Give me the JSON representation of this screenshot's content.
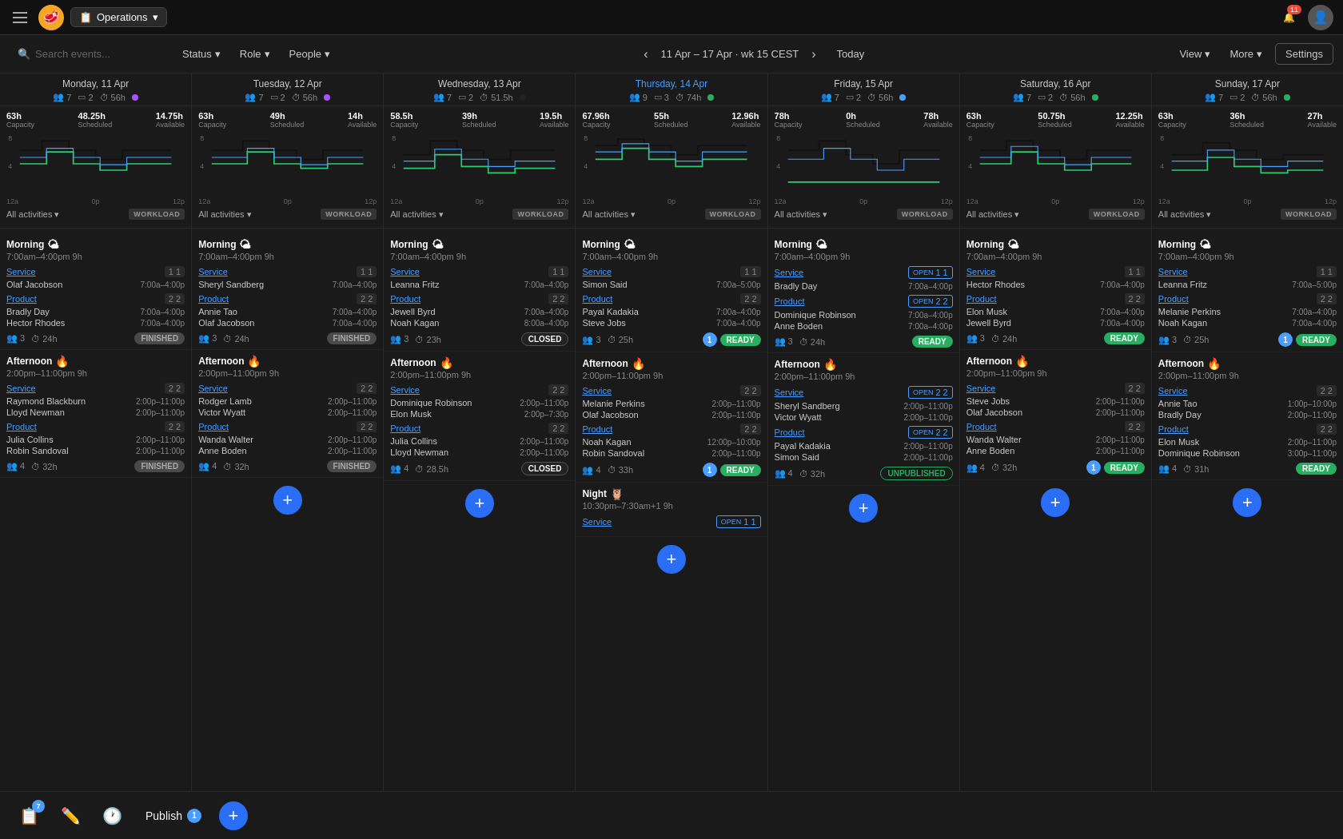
{
  "app": {
    "title": "Operations",
    "notif_count": "11"
  },
  "toolbar": {
    "search_placeholder": "Search events...",
    "status_label": "Status",
    "role_label": "Role",
    "people_label": "People",
    "week_label": "11 Apr – 17 Apr · wk 15   CEST",
    "today_label": "Today",
    "view_label": "View",
    "more_label": "More",
    "settings_label": "Settings"
  },
  "days": [
    {
      "title": "Monday, 11 Apr",
      "today": false,
      "stats": {
        "people": 7,
        "shifts": 2,
        "hours": "56h",
        "dot": "purple"
      },
      "capacity": {
        "cap": "63h",
        "sched": "48.25h",
        "avail": "14.75h"
      },
      "dot_color": "#a855f7",
      "shifts": [
        {
          "name": "Morning",
          "emoji": "🌤",
          "time": "7:00am–4:00pm 9h",
          "roles": [
            {
              "name": "Service",
              "count": "1 1",
              "open": false,
              "staff": [
                {
                  "name": "Olaf Jacobson",
                  "time": "7:00a–4:00p"
                }
              ]
            },
            {
              "name": "Product",
              "count": "2 2",
              "open": false,
              "staff": [
                {
                  "name": "Bradly Day",
                  "time": "7:00a–4:00p"
                },
                {
                  "name": "Hector Rhodes",
                  "time": "7:00a–4:00p"
                }
              ]
            }
          ],
          "footer": {
            "people": 3,
            "hours": "24h",
            "status": "FINISHED",
            "status_type": "finished",
            "num": null
          }
        },
        {
          "name": "Afternoon",
          "emoji": "🔥",
          "time": "2:00pm–11:00pm 9h",
          "roles": [
            {
              "name": "Service",
              "count": "2 2",
              "open": false,
              "staff": [
                {
                  "name": "Raymond Blackburn",
                  "time": "2:00p–11:00p"
                },
                {
                  "name": "Lloyd Newman",
                  "time": "2:00p–11:00p"
                }
              ]
            },
            {
              "name": "Product",
              "count": "2 2",
              "open": false,
              "staff": [
                {
                  "name": "Julia Collins",
                  "time": "2:00p–11:00p"
                },
                {
                  "name": "Robin Sandoval",
                  "time": "2:00p–11:00p"
                }
              ]
            }
          ],
          "footer": {
            "people": 4,
            "hours": "32h",
            "status": "FINISHED",
            "status_type": "finished",
            "num": null
          }
        }
      ]
    },
    {
      "title": "Tuesday, 12 Apr",
      "today": false,
      "stats": {
        "people": 7,
        "shifts": 2,
        "hours": "56h",
        "dot": "purple"
      },
      "capacity": {
        "cap": "63h",
        "sched": "49h",
        "avail": "14h"
      },
      "dot_color": "#a855f7",
      "shifts": [
        {
          "name": "Morning",
          "emoji": "🌤",
          "time": "7:00am–4:00pm 9h",
          "roles": [
            {
              "name": "Service",
              "count": "1 1",
              "open": false,
              "staff": [
                {
                  "name": "Sheryl Sandberg",
                  "time": "7:00a–4:00p"
                }
              ]
            },
            {
              "name": "Product",
              "count": "2 2",
              "open": false,
              "staff": [
                {
                  "name": "Annie Tao",
                  "time": "7:00a–4:00p"
                },
                {
                  "name": "Olaf Jacobson",
                  "time": "7:00a–4:00p"
                }
              ]
            }
          ],
          "footer": {
            "people": 3,
            "hours": "24h",
            "status": "FINISHED",
            "status_type": "finished",
            "num": null
          }
        },
        {
          "name": "Afternoon",
          "emoji": "🔥",
          "time": "2:00pm–11:00pm 9h",
          "roles": [
            {
              "name": "Service",
              "count": "2 2",
              "open": false,
              "staff": [
                {
                  "name": "Rodger Lamb",
                  "time": "2:00p–11:00p"
                },
                {
                  "name": "Victor Wyatt",
                  "time": "2:00p–11:00p"
                }
              ]
            },
            {
              "name": "Product",
              "count": "2 2",
              "open": false,
              "staff": [
                {
                  "name": "Wanda Walter",
                  "time": "2:00p–11:00p"
                },
                {
                  "name": "Anne Boden",
                  "time": "2:00p–11:00p"
                }
              ]
            }
          ],
          "footer": {
            "people": 4,
            "hours": "32h",
            "status": "FINISHED",
            "status_type": "finished",
            "num": null
          }
        }
      ]
    },
    {
      "title": "Wednesday, 13 Apr",
      "today": false,
      "stats": {
        "people": 7,
        "shifts": 2,
        "hours": "51.5h"
      },
      "capacity": {
        "cap": "58.5h",
        "sched": "39h",
        "avail": "19.5h"
      },
      "dot_color": "#222",
      "shifts": [
        {
          "name": "Morning",
          "emoji": "🌤",
          "time": "7:00am–4:00pm 9h",
          "roles": [
            {
              "name": "Service",
              "count": "1 1",
              "open": false,
              "staff": [
                {
                  "name": "Leanna Fritz",
                  "time": "7:00a–4:00p"
                }
              ]
            },
            {
              "name": "Product",
              "count": "2 2",
              "open": false,
              "staff": [
                {
                  "name": "Jewell Byrd",
                  "time": "7:00a–4:00p"
                },
                {
                  "name": "Noah Kagan",
                  "time": "8:00a–4:00p"
                }
              ]
            }
          ],
          "footer": {
            "people": 3,
            "hours": "23h",
            "status": "CLOSED",
            "status_type": "closed",
            "num": null
          }
        },
        {
          "name": "Afternoon",
          "emoji": "🔥",
          "time": "2:00pm–11:00pm 9h",
          "roles": [
            {
              "name": "Service",
              "count": "2 2",
              "open": false,
              "staff": [
                {
                  "name": "Dominique Robinson",
                  "time": "2:00p–11:00p"
                },
                {
                  "name": "Elon Musk",
                  "time": "2:00p–7:30p"
                }
              ]
            },
            {
              "name": "Product",
              "count": "2 2",
              "open": false,
              "staff": [
                {
                  "name": "Julia Collins",
                  "time": "2:00p–11:00p"
                },
                {
                  "name": "Lloyd Newman",
                  "time": "2:00p–11:00p"
                }
              ]
            }
          ],
          "footer": {
            "people": 4,
            "hours": "28.5h",
            "status": "CLOSED",
            "status_type": "closed",
            "num": null
          }
        }
      ]
    },
    {
      "title": "Thursday, 14 Apr",
      "today": true,
      "stats": {
        "people": 9,
        "shifts": 3,
        "hours": "74h"
      },
      "capacity": {
        "cap": "67.96h",
        "sched": "55h",
        "avail": "12.96h"
      },
      "dot_color": "#27ae60",
      "shifts": [
        {
          "name": "Morning",
          "emoji": "🌤",
          "time": "7:00am–4:00pm 9h",
          "roles": [
            {
              "name": "Service",
              "count": "1 1",
              "open": false,
              "staff": [
                {
                  "name": "Simon Said",
                  "time": "7:00a–5:00p"
                }
              ]
            },
            {
              "name": "Product",
              "count": "2 2",
              "open": false,
              "staff": [
                {
                  "name": "Payal Kadakia",
                  "time": "7:00a–4:00p"
                },
                {
                  "name": "Steve Jobs",
                  "time": "7:00a–4:00p"
                }
              ]
            }
          ],
          "footer": {
            "people": 3,
            "hours": "25h",
            "status": "READY",
            "status_type": "ready",
            "num": 1
          }
        },
        {
          "name": "Afternoon",
          "emoji": "🔥",
          "time": "2:00pm–11:00pm 9h",
          "roles": [
            {
              "name": "Service",
              "count": "2 2",
              "open": false,
              "staff": [
                {
                  "name": "Melanie Perkins",
                  "time": "2:00p–11:00p"
                },
                {
                  "name": "Olaf Jacobson",
                  "time": "2:00p–11:00p"
                }
              ]
            },
            {
              "name": "Product",
              "count": "2 2",
              "open": false,
              "staff": [
                {
                  "name": "Noah Kagan",
                  "time": "12:00p–10:00p"
                },
                {
                  "name": "Robin Sandoval",
                  "time": "2:00p–11:00p"
                }
              ]
            }
          ],
          "footer": {
            "people": 4,
            "hours": "33h",
            "status": "READY",
            "status_type": "ready",
            "num": 1
          }
        },
        {
          "name": "Night",
          "emoji": "🦉",
          "time": "10:30pm–7:30am+1 9h",
          "roles": [
            {
              "name": "Service",
              "count": "1 1",
              "open": true,
              "staff": []
            }
          ],
          "footer": null
        }
      ]
    },
    {
      "title": "Friday, 15 Apr",
      "today": false,
      "stats": {
        "people": 7,
        "shifts": 2,
        "hours": "56h"
      },
      "capacity": {
        "cap": "78h",
        "sched": "0h",
        "avail": "78h"
      },
      "dot_color": "#4a9eff",
      "shifts": [
        {
          "name": "Morning",
          "emoji": "🌤",
          "time": "7:00am–4:00pm 9h",
          "roles": [
            {
              "name": "Service",
              "count": "1 1",
              "open": true,
              "staff": [
                {
                  "name": "Bradly Day",
                  "time": "7:00a–4:00p"
                }
              ]
            },
            {
              "name": "Product",
              "count": "2 2",
              "open": true,
              "staff": [
                {
                  "name": "Dominique Robinson",
                  "time": "7:00a–4:00p"
                },
                {
                  "name": "Anne Boden",
                  "time": "7:00a–4:00p"
                }
              ]
            }
          ],
          "footer": {
            "people": 3,
            "hours": "24h",
            "status": "READY",
            "status_type": "ready",
            "num": null
          }
        },
        {
          "name": "Afternoon",
          "emoji": "🔥",
          "time": "2:00pm–11:00pm 9h",
          "roles": [
            {
              "name": "Service",
              "count": "2 2",
              "open": true,
              "staff": [
                {
                  "name": "Sheryl Sandberg",
                  "time": "2:00p–11:00p"
                },
                {
                  "name": "Victor Wyatt",
                  "time": "2:00p–11:00p"
                }
              ]
            },
            {
              "name": "Product",
              "count": "2 2",
              "open": true,
              "staff": [
                {
                  "name": "Payal Kadakia",
                  "time": "2:00p–11:00p"
                },
                {
                  "name": "Simon Said",
                  "time": "2:00p–11:00p"
                }
              ]
            }
          ],
          "footer": {
            "people": 4,
            "hours": "32h",
            "status": "UNPUBLISHED",
            "status_type": "unpublished",
            "num": null
          }
        }
      ]
    },
    {
      "title": "Saturday, 16 Apr",
      "today": false,
      "stats": {
        "people": 7,
        "shifts": 2,
        "hours": "56h"
      },
      "capacity": {
        "cap": "63h",
        "sched": "50.75h",
        "avail": "12.25h"
      },
      "dot_color": "#27ae60",
      "shifts": [
        {
          "name": "Morning",
          "emoji": "🌤",
          "time": "7:00am–4:00pm 9h",
          "roles": [
            {
              "name": "Service",
              "count": "1 1",
              "open": false,
              "staff": [
                {
                  "name": "Hector Rhodes",
                  "time": "7:00a–4:00p"
                }
              ]
            },
            {
              "name": "Product",
              "count": "2 2",
              "open": false,
              "staff": [
                {
                  "name": "Elon Musk",
                  "time": "7:00a–4:00p"
                },
                {
                  "name": "Jewell Byrd",
                  "time": "7:00a–4:00p"
                }
              ]
            }
          ],
          "footer": {
            "people": 3,
            "hours": "24h",
            "status": "READY",
            "status_type": "ready",
            "num": null
          }
        },
        {
          "name": "Afternoon",
          "emoji": "🔥",
          "time": "2:00pm–11:00pm 9h",
          "roles": [
            {
              "name": "Service",
              "count": "2 2",
              "open": false,
              "staff": [
                {
                  "name": "Steve Jobs",
                  "time": "2:00p–11:00p"
                },
                {
                  "name": "Olaf Jacobson",
                  "time": "2:00p–11:00p"
                }
              ]
            },
            {
              "name": "Product",
              "count": "2 2",
              "open": false,
              "staff": [
                {
                  "name": "Wanda Walter",
                  "time": "2:00p–11:00p"
                },
                {
                  "name": "Anne Boden",
                  "time": "2:00p–11:00p"
                }
              ]
            }
          ],
          "footer": {
            "people": 4,
            "hours": "32h",
            "status": "READY",
            "status_type": "ready",
            "num": 1
          }
        }
      ]
    },
    {
      "title": "Sunday, 17 Apr",
      "today": false,
      "stats": {
        "people": 7,
        "shifts": 2,
        "hours": "56h"
      },
      "capacity": {
        "cap": "63h",
        "sched": "36h",
        "avail": "27h"
      },
      "dot_color": "#27ae60",
      "shifts": [
        {
          "name": "Morning",
          "emoji": "🌤",
          "time": "7:00am–4:00pm 9h",
          "roles": [
            {
              "name": "Service",
              "count": "1 1",
              "open": false,
              "staff": [
                {
                  "name": "Leanna Fritz",
                  "time": "7:00a–5:00p"
                }
              ]
            },
            {
              "name": "Product",
              "count": "2 2",
              "open": false,
              "staff": [
                {
                  "name": "Melanie Perkins",
                  "time": "7:00a–4:00p"
                },
                {
                  "name": "Noah Kagan",
                  "time": "7:00a–4:00p"
                }
              ]
            }
          ],
          "footer": {
            "people": 3,
            "hours": "25h",
            "status": "READY",
            "status_type": "ready",
            "num": 1
          }
        },
        {
          "name": "Afternoon",
          "emoji": "🔥",
          "time": "2:00pm–11:00pm 9h",
          "roles": [
            {
              "name": "Service",
              "count": "2 2",
              "open": false,
              "staff": [
                {
                  "name": "Annie Tao",
                  "time": "1:00p–10:00p"
                },
                {
                  "name": "Bradly Day",
                  "time": "2:00p–11:00p"
                }
              ]
            },
            {
              "name": "Product",
              "count": "2 2",
              "open": false,
              "staff": [
                {
                  "name": "Elon Musk",
                  "time": "2:00p–11:00p"
                },
                {
                  "name": "Dominique Robinson",
                  "time": "3:00p–11:00p"
                }
              ]
            }
          ],
          "footer": {
            "people": 4,
            "hours": "31h",
            "status": "READY",
            "status_type": "ready",
            "num": null
          }
        }
      ]
    }
  ],
  "bottom": {
    "publish_label": "Publish",
    "publish_count": "1",
    "unread_count": "7"
  }
}
